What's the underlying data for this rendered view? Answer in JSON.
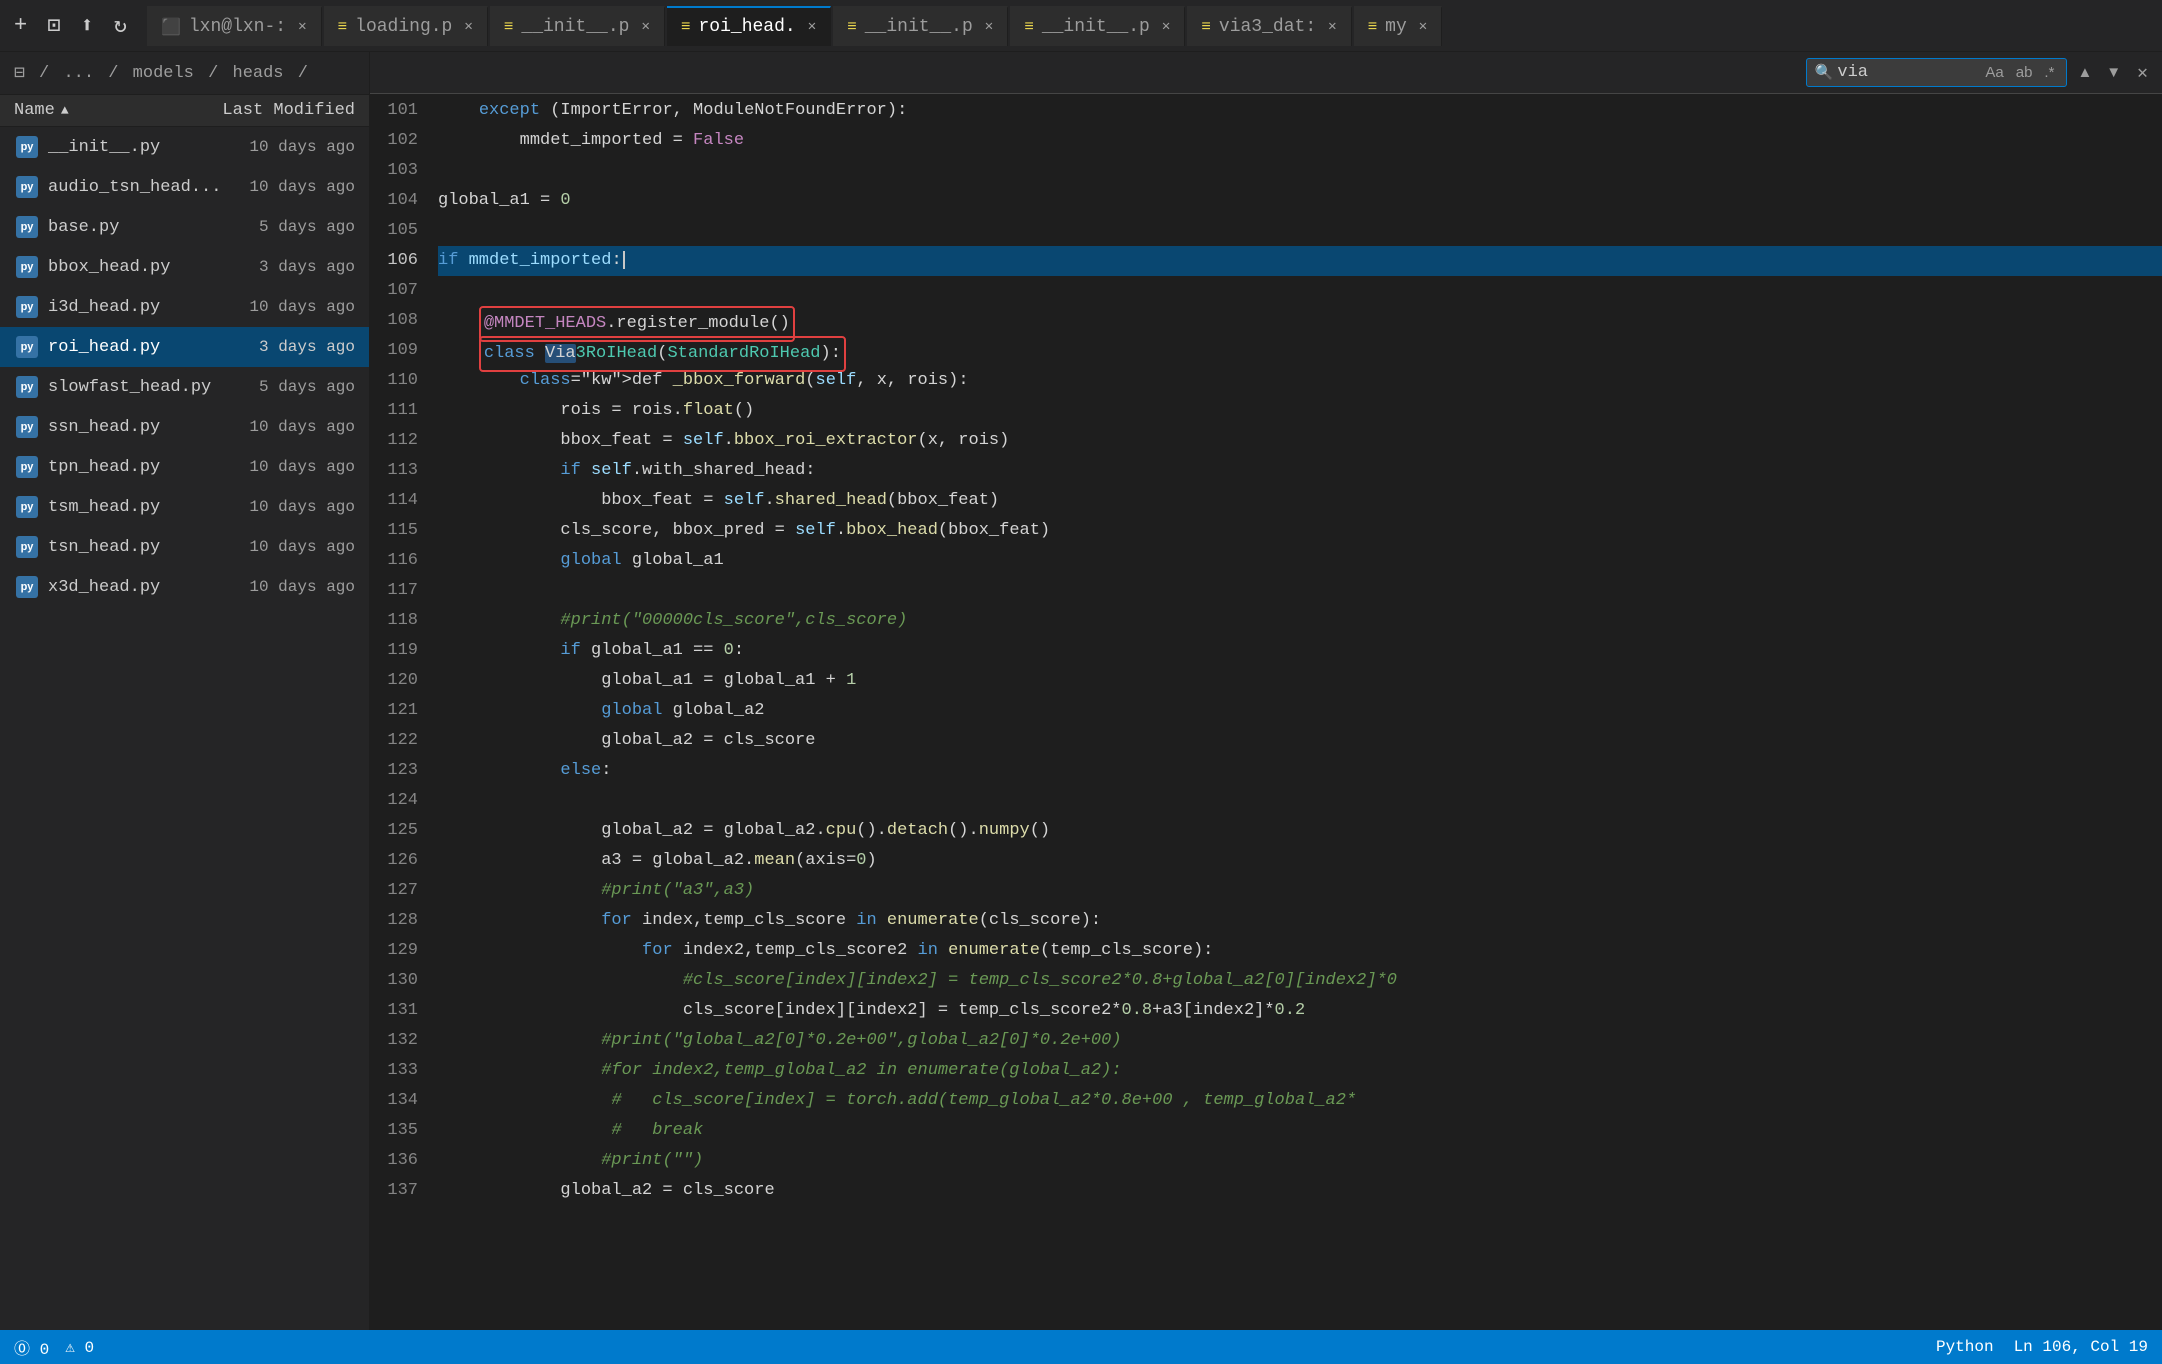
{
  "tabs": [
    {
      "id": "lxn",
      "label": "lxn@lxn-:",
      "icon": "terminal",
      "active": false
    },
    {
      "id": "loading",
      "label": "loading.p",
      "icon": "python",
      "active": false
    },
    {
      "id": "init1",
      "label": "__init__.p",
      "icon": "python",
      "active": false
    },
    {
      "id": "roi_head",
      "label": "roi_head.",
      "icon": "python",
      "active": true
    },
    {
      "id": "init2",
      "label": "__init__.p",
      "icon": "python",
      "active": false
    },
    {
      "id": "init3",
      "label": "__init__.p",
      "icon": "python",
      "active": false
    },
    {
      "id": "via3_data",
      "label": "via3_dat:",
      "icon": "python",
      "active": false
    },
    {
      "id": "my",
      "label": "my",
      "icon": "python",
      "active": false
    }
  ],
  "sidebar": {
    "breadcrumb": [
      "⊟",
      "/",
      "...",
      "/",
      "models",
      "/",
      "heads",
      "/"
    ],
    "col_name": "Name",
    "col_modified": "Last Modified",
    "files": [
      {
        "name": "__init__.py",
        "modified": "10 days ago"
      },
      {
        "name": "audio_tsn_head...",
        "modified": "10 days ago"
      },
      {
        "name": "base.py",
        "modified": "5 days ago"
      },
      {
        "name": "bbox_head.py",
        "modified": "3 days ago"
      },
      {
        "name": "i3d_head.py",
        "modified": "10 days ago"
      },
      {
        "name": "roi_head.py",
        "modified": "3 days ago",
        "active": true
      },
      {
        "name": "slowfast_head.py",
        "modified": "5 days ago"
      },
      {
        "name": "ssn_head.py",
        "modified": "10 days ago"
      },
      {
        "name": "tpn_head.py",
        "modified": "10 days ago"
      },
      {
        "name": "tsm_head.py",
        "modified": "10 days ago"
      },
      {
        "name": "tsn_head.py",
        "modified": "10 days ago"
      },
      {
        "name": "x3d_head.py",
        "modified": "10 days ago"
      }
    ]
  },
  "find_bar": {
    "value": "via",
    "placeholder": "Find"
  },
  "status_bar": {
    "error_count": "⓪",
    "warning_count": "0",
    "language": "Python",
    "position": "Ln 106, Col 19"
  },
  "code_lines": [
    {
      "num": 101,
      "content": "    except (ImportError, ModuleNotFoundError):"
    },
    {
      "num": 102,
      "content": "        mmdet_imported = False"
    },
    {
      "num": 103,
      "content": ""
    },
    {
      "num": 104,
      "content": "global_a1 = 0"
    },
    {
      "num": 105,
      "content": ""
    },
    {
      "num": 106,
      "content": "if mmdet_imported:",
      "cursor": true
    },
    {
      "num": 107,
      "content": ""
    },
    {
      "num": 108,
      "content": "    @MMDET_HEADS.register_module()",
      "boxed": true
    },
    {
      "num": 109,
      "content": "    class Via3RoIHead(StandardRoIHead):",
      "boxed": true
    },
    {
      "num": 110,
      "content": "        def _bbox_forward(self, x, rois):"
    },
    {
      "num": 111,
      "content": "            rois = rois.float()"
    },
    {
      "num": 112,
      "content": "            bbox_feat = self.bbox_roi_extractor(x, rois)"
    },
    {
      "num": 113,
      "content": "            if self.with_shared_head:"
    },
    {
      "num": 114,
      "content": "                bbox_feat = self.shared_head(bbox_feat)"
    },
    {
      "num": 115,
      "content": "            cls_score, bbox_pred = self.bbox_head(bbox_feat)"
    },
    {
      "num": 116,
      "content": "            global global_a1"
    },
    {
      "num": 117,
      "content": ""
    },
    {
      "num": 118,
      "content": "            #print(\"00000cls_score\",cls_score)"
    },
    {
      "num": 119,
      "content": "            if global_a1 == 0:"
    },
    {
      "num": 120,
      "content": "                global_a1 = global_a1 + 1"
    },
    {
      "num": 121,
      "content": "                global global_a2"
    },
    {
      "num": 122,
      "content": "                global_a2 = cls_score"
    },
    {
      "num": 123,
      "content": "            else:"
    },
    {
      "num": 124,
      "content": ""
    },
    {
      "num": 125,
      "content": "                global_a2 = global_a2.cpu().detach().numpy()"
    },
    {
      "num": 126,
      "content": "                a3 = global_a2.mean(axis=0)"
    },
    {
      "num": 127,
      "content": "                #print(\"a3\",a3)"
    },
    {
      "num": 128,
      "content": "                for index,temp_cls_score in enumerate(cls_score):"
    },
    {
      "num": 129,
      "content": "                    for index2,temp_cls_score2 in enumerate(temp_cls_score):"
    },
    {
      "num": 130,
      "content": "                        #cls_score[index][index2] = temp_cls_score2*0.8+global_a2[0][index2]*0"
    },
    {
      "num": 131,
      "content": "                        cls_score[index][index2] = temp_cls_score2*0.8+a3[index2]*0.2"
    },
    {
      "num": 132,
      "content": "                #print(\"global_a2[0]*0.2e+00\",global_a2[0]*0.2e+00)"
    },
    {
      "num": 133,
      "content": "                #for index2,temp_global_a2 in enumerate(global_a2):"
    },
    {
      "num": 134,
      "content": "                 #   cls_score[index] = torch.add(temp_global_a2*0.8e+00 , temp_global_a2*"
    },
    {
      "num": 135,
      "content": "                 #   break"
    },
    {
      "num": 136,
      "content": "                #print(\"\")"
    },
    {
      "num": 137,
      "content": "            global_a2 = cls_score"
    }
  ]
}
